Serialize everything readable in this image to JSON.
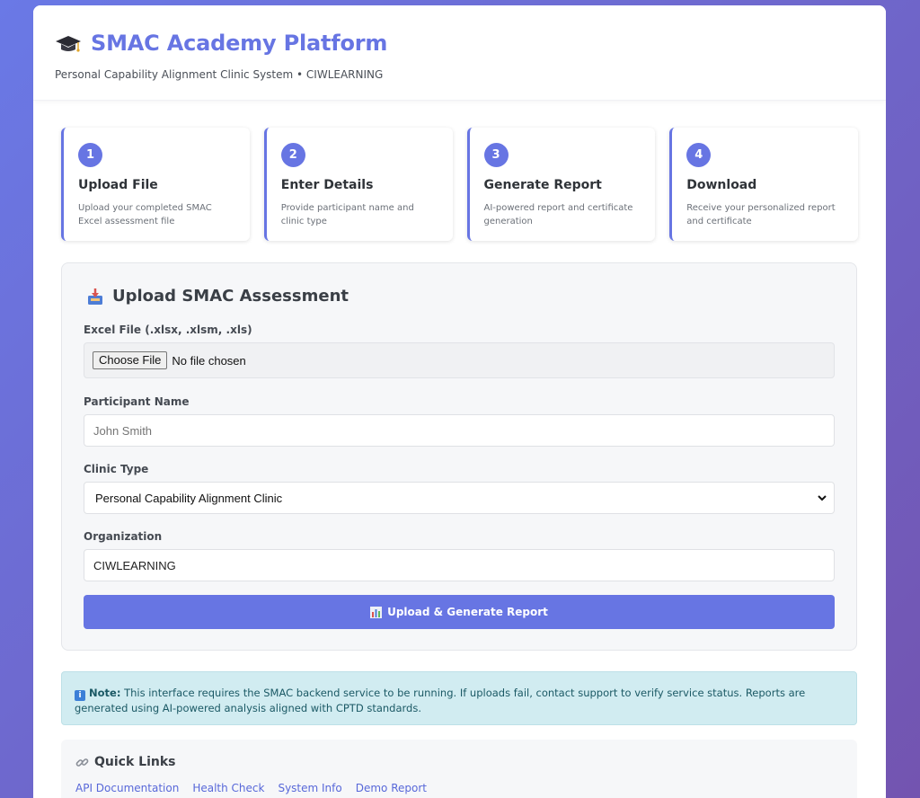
{
  "header": {
    "icon": "graduation-cap-icon",
    "title": "SMAC Academy Platform",
    "subtitle": "Personal Capability Alignment Clinic System • CIWLEARNING"
  },
  "steps": [
    {
      "num": "1",
      "title": "Upload File",
      "desc": "Upload your completed SMAC Excel assessment file"
    },
    {
      "num": "2",
      "title": "Enter Details",
      "desc": "Provide participant name and clinic type"
    },
    {
      "num": "3",
      "title": "Generate Report",
      "desc": "AI-powered report and certificate generation"
    },
    {
      "num": "4",
      "title": "Download",
      "desc": "Receive your personalized report and certificate"
    }
  ],
  "upload": {
    "icon": "inbox-tray-icon",
    "title": "Upload SMAC Assessment",
    "file_label": "Excel File (.xlsx, .xlsm, .xls)",
    "file_button": "Choose File",
    "file_status": "No file chosen",
    "name_label": "Participant Name",
    "name_placeholder": "John Smith",
    "clinic_label": "Clinic Type",
    "clinic_value": "Personal Capability Alignment Clinic",
    "org_label": "Organization",
    "org_value": "CIWLEARNING",
    "submit_label": "Upload & Generate Report",
    "submit_icon": "bar-chart-icon"
  },
  "note": {
    "icon": "info-icon",
    "icon_glyph": "i",
    "label": "Note:",
    "text": " This interface requires the SMAC backend service to be running. If uploads fail, contact support to verify service status. Reports are generated using AI-powered analysis aligned with CPTD standards."
  },
  "quick_links": {
    "icon": "link-icon",
    "title": "Quick Links",
    "items": [
      "API Documentation",
      "Health Check",
      "System Info",
      "Demo Report"
    ]
  },
  "colors": {
    "accent": "#6775e3",
    "note_bg": "#d1ecf1",
    "note_text": "#1b5965",
    "link": "#5868d9"
  }
}
